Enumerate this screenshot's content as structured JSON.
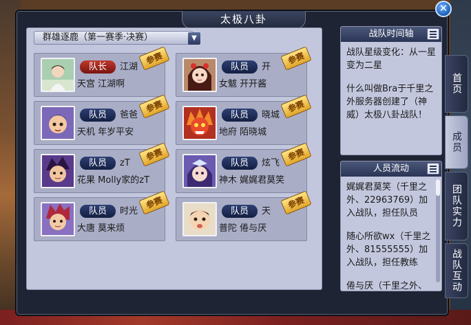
{
  "window": {
    "title": "太极八卦",
    "close_label": "✕"
  },
  "season_select": {
    "value": "群雄逐鹿（第一赛季·决赛）",
    "arrow": "▼"
  },
  "members": [
    {
      "role": "队长",
      "name": "江湖",
      "server": "天宫",
      "nickname": "江湖啊",
      "tag": "参赛",
      "avatar": "scholar-avatar"
    },
    {
      "role": "队员",
      "name": "开",
      "server": "女魃",
      "nickname": "开开酱",
      "tag": "参赛",
      "avatar": "girl-avatar"
    },
    {
      "role": "队员",
      "name": "爸爸",
      "server": "天机",
      "nickname": "年岁平安",
      "tag": "参赛",
      "avatar": "boy-avatar"
    },
    {
      "role": "队员",
      "name": "晓城",
      "server": "地府",
      "nickname": "陌晓城",
      "tag": "参赛",
      "avatar": "demon-avatar"
    },
    {
      "role": "队员",
      "name": "zT",
      "server": "花果",
      "nickname": "Molly家的zT",
      "tag": "参赛",
      "avatar": "warrior-avatar"
    },
    {
      "role": "队员",
      "name": "炫飞",
      "server": "神木",
      "nickname": "娓娓君莫笑",
      "tag": "参赛",
      "avatar": "fairy-avatar"
    },
    {
      "role": "队员",
      "name": "时光",
      "server": "大唐",
      "nickname": "莫来烦",
      "tag": "参赛",
      "avatar": "swordsman-avatar"
    },
    {
      "role": "队员",
      "name": "天",
      "server": "普陀",
      "nickname": "倦与厌",
      "tag": "参赛",
      "avatar": "baby-photo-avatar"
    }
  ],
  "timeline": {
    "title": "战队时间轴",
    "entries": [
      "战队星级变化：从一星变为二星",
      "什么叫做Bra于千里之外服务器创建了（神威）太极八卦战队！"
    ]
  },
  "flow": {
    "title": "人员流动",
    "entries": [
      "娓娓君莫笑（千里之外、22963769）加入战队，担任队员",
      "随心所欲wx（千里之外、81555555）加入战队，担任教练",
      "倦与厌（千里之外、"
    ]
  },
  "tabs": [
    "首页",
    "成员",
    "团队实力",
    "战队互动"
  ],
  "colors": {
    "captain_badge": "#c0392b",
    "member_badge": "#1f2d58",
    "tag": "#f0c040"
  }
}
